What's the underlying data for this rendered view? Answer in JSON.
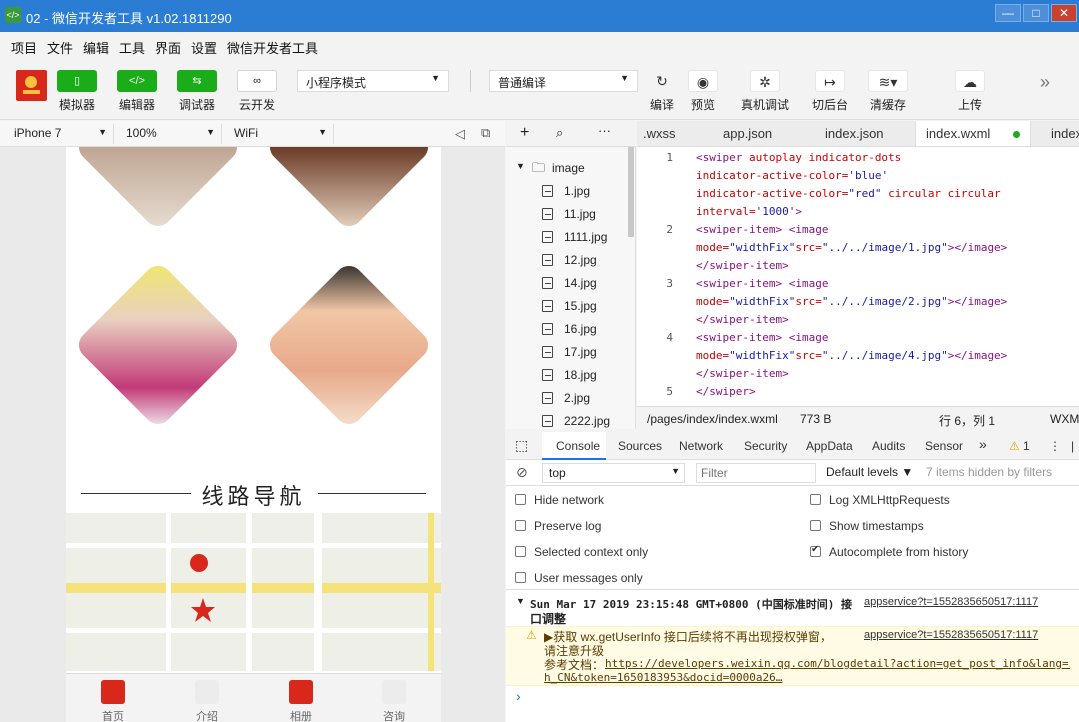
{
  "window": {
    "title": "02 - 微信开发者工具 v1.02.1811290",
    "app_icon": "</>",
    "minimize": "—",
    "maximize": "□",
    "close": "✕"
  },
  "menu": [
    "项目",
    "文件",
    "编辑",
    "工具",
    "界面",
    "设置",
    "微信开发者工具"
  ],
  "toolbar": {
    "simulator": "模拟器",
    "editor": "编辑器",
    "debugger": "调试器",
    "cloud": "云开发",
    "mode": "小程序模式",
    "compile_mode": "普通编译",
    "compile": "编译",
    "preview": "预览",
    "remote_debug": "真机调试",
    "background": "切后台",
    "clear_cache": "清缓存",
    "upload": "上传",
    "more": "»"
  },
  "simulator": {
    "device": "iPhone 7",
    "zoom": "100%",
    "network": "WiFi"
  },
  "phone": {
    "nav_title": "线路导航",
    "tabs": [
      "首页",
      "介绍",
      "相册",
      "咨询"
    ],
    "brand_color": "#d8281c"
  },
  "filetree": {
    "folder": "image",
    "files": [
      "1.jpg",
      "11.jpg",
      "1111.jpg",
      "12.jpg",
      "14.jpg",
      "15.jpg",
      "16.jpg",
      "17.jpg",
      "18.jpg",
      "2.jpg",
      "2222.jpg"
    ]
  },
  "editor": {
    "tabs": [
      ".wxss",
      "app.json",
      "index.json",
      "index.wxml",
      "index"
    ],
    "active_tab": "index.wxml",
    "line_numbers": [
      "1",
      "2",
      "3",
      "4",
      "5"
    ]
  },
  "status": {
    "path": "/pages/index/index.wxml",
    "size": "773 B",
    "position": "行 6，列 1",
    "lang": "WXM"
  },
  "devtools": {
    "tabs": [
      "Console",
      "Sources",
      "Network",
      "Security",
      "AppData",
      "Audits",
      "Sensor"
    ],
    "more": "»",
    "warnings": "1",
    "context": "top",
    "filter_placeholder": "Filter",
    "levels": "Default levels ▼",
    "hidden": "7 items hidden by filters"
  },
  "settings": {
    "left": [
      "Hide network",
      "Preserve log",
      "Selected context only",
      "User messages only"
    ],
    "right": [
      "Log XMLHttpRequests",
      "Show timestamps",
      "Autocomplete from history"
    ]
  },
  "log": {
    "header": "Sun Mar 17 2019 23:15:48 GMT+0800 (中国标准时间) 接",
    "header2": "口调整",
    "source": "appservice?t=1552835650517:1117",
    "warn_source": "appservice?t=1552835650517:1117",
    "warn_line1": "▶获取 wx.getUserInfo 接口后续将不再出现授权弹窗，",
    "warn_line2": "请注意升级",
    "warn_line3": "参考文档：",
    "warn_link": "https://developers.weixin.qq.com/blogdetail?action=get_post_info&lang=z",
    "warn_link2": "h_CN&token=1650183953&docid=0000a26…",
    "prompt": "›"
  }
}
